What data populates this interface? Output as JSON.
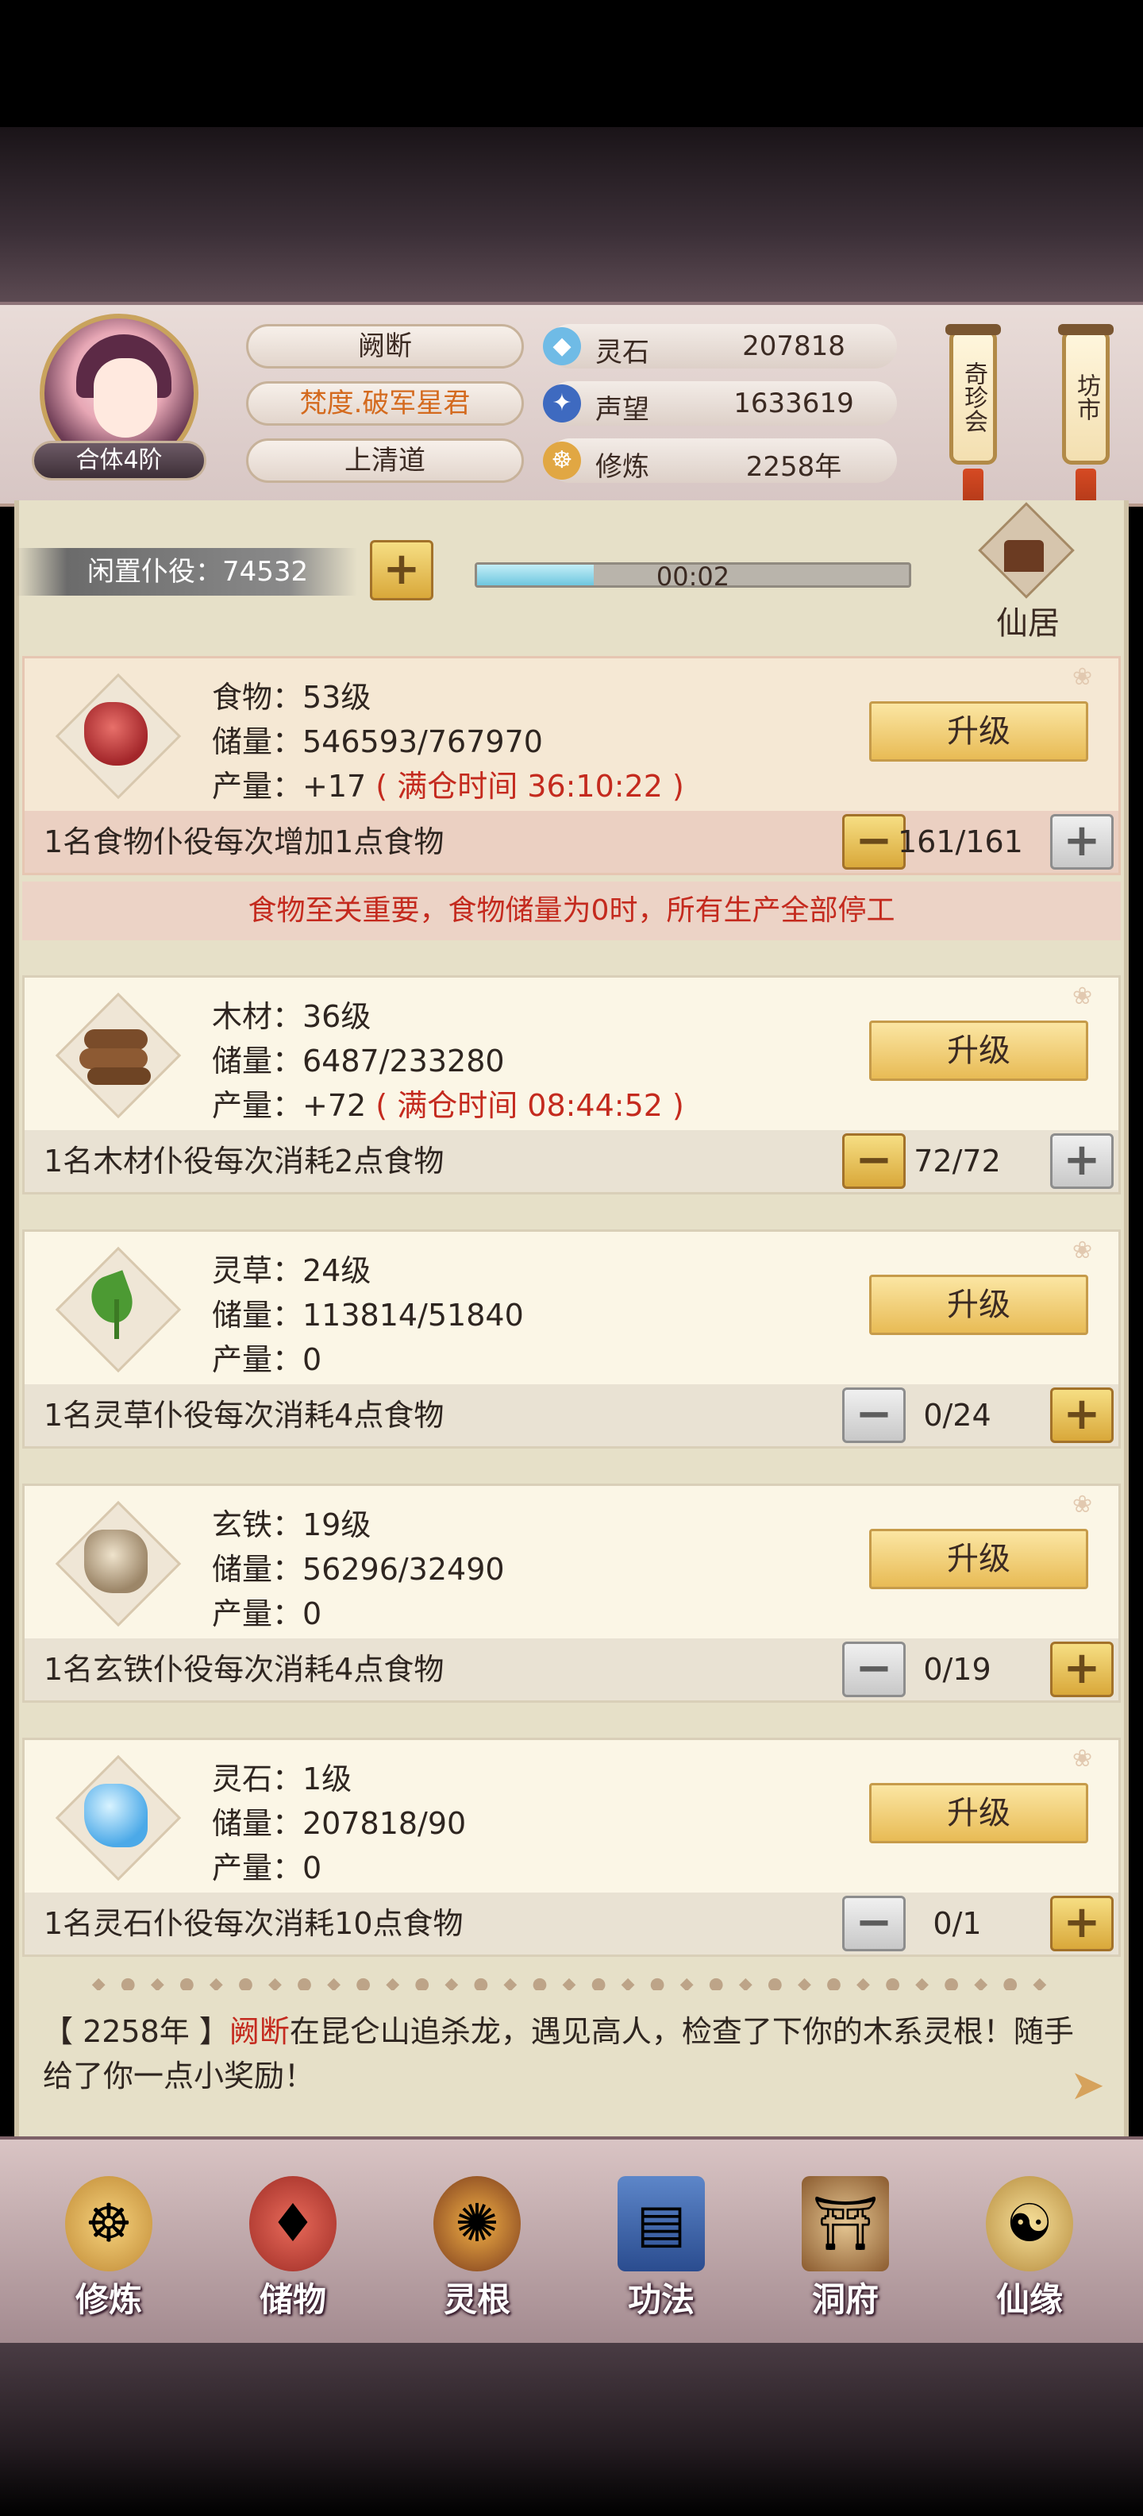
{
  "header": {
    "rank": "合体4阶",
    "name": "阙断",
    "title": "梵度.破军星君",
    "sect": "上清道",
    "resources": [
      {
        "label": "灵石",
        "value": "207818",
        "icon": "spirit-stone-icon"
      },
      {
        "label": "声望",
        "value": "1633619",
        "icon": "reputation-icon"
      },
      {
        "label": "修炼",
        "value": "2258年",
        "icon": "meditation-icon"
      }
    ],
    "lanterns": [
      "奇珍会",
      "坊市"
    ]
  },
  "status": {
    "idle_label": "闲置仆役：74532",
    "timer": "00:02",
    "timer_progress": 0.27,
    "xianju_label": "仙居"
  },
  "cards": [
    {
      "level": "食物：53级",
      "storage": "储量：546593/767970",
      "output_prefix": "产量：+17",
      "output_full": "( 满仓时间 36:10:22 )",
      "upgrade": "升级",
      "worker_text": "1名食物仆役每次增加1点食物",
      "count": "161/161"
    },
    {
      "level": "木材：36级",
      "storage": "储量：6487/233280",
      "output_prefix": "产量：+72",
      "output_full": "( 满仓时间 08:44:52 )",
      "upgrade": "升级",
      "worker_text": "1名木材仆役每次消耗2点食物",
      "count": "72/72"
    },
    {
      "level": "灵草：24级",
      "storage": "储量：113814/51840",
      "output_prefix": "产量：0",
      "output_full": "",
      "upgrade": "升级",
      "worker_text": "1名灵草仆役每次消耗4点食物",
      "count": "0/24"
    },
    {
      "level": "玄铁：19级",
      "storage": "储量：56296/32490",
      "output_prefix": "产量：0",
      "output_full": "",
      "upgrade": "升级",
      "worker_text": "1名玄铁仆役每次消耗4点食物",
      "count": "0/19"
    },
    {
      "level": "灵石：1级",
      "storage": "储量：207818/90",
      "output_prefix": "产量：0",
      "output_full": "",
      "upgrade": "升级",
      "worker_text": "1名灵石仆役每次消耗10点食物",
      "count": "0/1"
    }
  ],
  "warning": "食物至关重要，食物储量为0时，所有生产全部停工",
  "log": {
    "year": "【 2258年 】",
    "name": "阙断",
    "text": "在昆仑山追杀龙，遇见高人，检查了下你的木系灵根！随手给了你一点小奖励！"
  },
  "nav": [
    "修炼",
    "储物",
    "灵根",
    "功法",
    "洞府",
    "仙缘"
  ],
  "colors": {
    "accent_red": "#c42a1e",
    "gold_button": "#e8bb55",
    "panel_bg": "#fbf6e6"
  }
}
